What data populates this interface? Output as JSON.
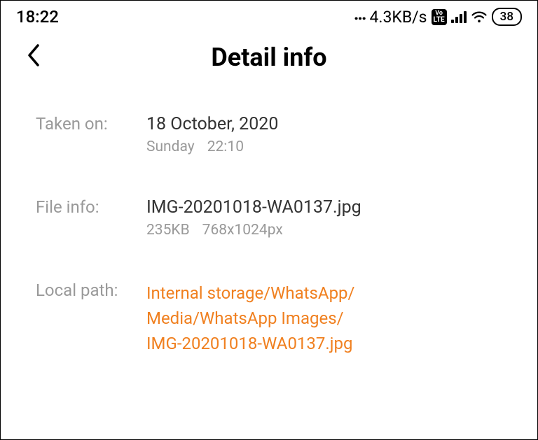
{
  "status_bar": {
    "time": "18:22",
    "dots": "...",
    "data_speed": "4.3KB/s",
    "volte_top": "Vo",
    "volte_bottom": "LTE",
    "battery": "38"
  },
  "header": {
    "title": "Detail info"
  },
  "details": {
    "taken_on": {
      "label": "Taken on:",
      "date": "18 October, 2020",
      "day": "Sunday",
      "time": "22:10"
    },
    "file_info": {
      "label": "File info:",
      "filename": "IMG-20201018-WA0137.jpg",
      "size": "235KB",
      "dimensions": "768x1024px"
    },
    "local_path": {
      "label": "Local path:",
      "line1": "Internal storage/WhatsApp/",
      "line2": "Media/WhatsApp Images/",
      "line3": "IMG-20201018-WA0137.jpg"
    }
  }
}
